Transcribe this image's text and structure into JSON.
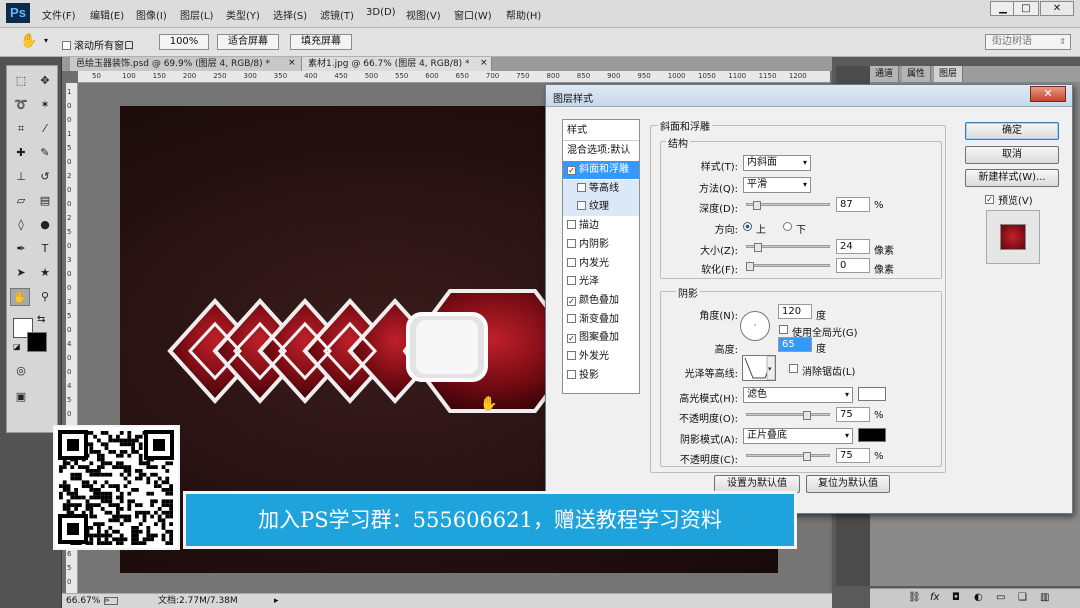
{
  "app": {
    "logo": "Ps"
  },
  "menu": [
    "文件(F)",
    "编辑(E)",
    "图像(I)",
    "图层(L)",
    "类型(Y)",
    "选择(S)",
    "滤镜(T)",
    "3D(D)",
    "视图(V)",
    "窗口(W)",
    "帮助(H)"
  ],
  "window_controls": {
    "minimize": "▁",
    "maximize": "□",
    "close": "✕"
  },
  "options_bar": {
    "hand_icon": "hand-icon",
    "scroll_all_label": "滚动所有窗口",
    "zoom_btn": "100%",
    "fit_btn": "适合屏幕",
    "fill_btn": "填充屏幕",
    "workspace_value": "街边树语"
  },
  "doc_tabs": [
    "邑绘玉器装饰.psd @ 69.9% (图层 4, RGB/8) *",
    "素材1.jpg @ 66.7% (图层 4, RGB/8) *"
  ],
  "ruler_top": [
    "50",
    "100",
    "150",
    "200",
    "250",
    "300",
    "350",
    "400",
    "450",
    "500",
    "550",
    "600",
    "650",
    "700",
    "750",
    "800",
    "850",
    "900",
    "950",
    "1000",
    "1050",
    "1100",
    "1150",
    "1200"
  ],
  "ruler_left": [
    "1",
    "0",
    "0",
    "1",
    "5",
    "0",
    "2",
    "0",
    "0",
    "2",
    "5",
    "0",
    "3",
    "0",
    "0",
    "3",
    "5",
    "0",
    "4",
    "0",
    "0",
    "4",
    "5",
    "0",
    "5",
    "0",
    "0",
    "5",
    "5",
    "0",
    "6",
    "0",
    "0",
    "6",
    "5",
    "0"
  ],
  "status": {
    "zoom": "66.67%",
    "doc": "文档:2.77M/7.38M"
  },
  "panel_tabs": [
    "通道",
    "属性",
    "图层"
  ],
  "dialog": {
    "title": "图层样式",
    "close": "✕",
    "styles_header": "样式",
    "blend_options": "混合选项:默认",
    "style_items": [
      {
        "label": "斜面和浮雕",
        "checked": true,
        "state": "sel"
      },
      {
        "label": "等高线",
        "checked": false,
        "state": "sub"
      },
      {
        "label": "纹理",
        "checked": false,
        "state": "sub"
      },
      {
        "label": "描边",
        "checked": false,
        "state": ""
      },
      {
        "label": "内阴影",
        "checked": false,
        "state": ""
      },
      {
        "label": "内发光",
        "checked": false,
        "state": ""
      },
      {
        "label": "光泽",
        "checked": false,
        "state": ""
      },
      {
        "label": "颜色叠加",
        "checked": true,
        "state": ""
      },
      {
        "label": "渐变叠加",
        "checked": false,
        "state": ""
      },
      {
        "label": "图案叠加",
        "checked": true,
        "state": ""
      },
      {
        "label": "外发光",
        "checked": false,
        "state": ""
      },
      {
        "label": "投影",
        "checked": false,
        "state": ""
      }
    ],
    "bevel_title": "斜面和浮雕",
    "structure": {
      "title": "结构",
      "style_label": "样式(T):",
      "style_value": "内斜面",
      "method_label": "方法(Q):",
      "method_value": "平滑",
      "depth_label": "深度(D):",
      "depth_value": "87",
      "depth_unit": "%",
      "depth_level": 0.09,
      "direction_label": "方向:",
      "dir_up": "上",
      "dir_down": "下",
      "size_label": "大小(Z):",
      "size_value": "24",
      "size_unit": "像素",
      "size_level": 0.1,
      "soften_label": "软化(F):",
      "soften_value": "0",
      "soften_unit": "像素",
      "soften_level": 0
    },
    "shading": {
      "title": "阴影",
      "angle_label": "角度(N):",
      "angle_value": "120",
      "angle_unit": "度",
      "global_light": "使用全局光(G)",
      "altitude_label": "高度:",
      "altitude_value": "65",
      "altitude_unit": "度",
      "gloss_label": "光泽等高线:",
      "antialias": "消除锯齿(L)",
      "highlight_label": "高光模式(H):",
      "highlight_value": "滤色",
      "highlight_color": "#ffffff",
      "hl_opacity_label": "不透明度(O):",
      "hl_opacity_value": "75",
      "hl_opacity_unit": "%",
      "hl_opacity_level": 0.75,
      "shadow_label": "阴影模式(A):",
      "shadow_value": "正片叠底",
      "shadow_color": "#000000",
      "sh_opacity_label": "不透明度(C):",
      "sh_opacity_value": "75",
      "sh_opacity_unit": "%",
      "sh_opacity_level": 0.75
    },
    "make_default": "设置为默认值",
    "reset_default": "复位为默认值",
    "ok": "确定",
    "cancel": "取消",
    "new_style": "新建样式(W)...",
    "preview": "预览(V)"
  },
  "banner": "加入PS学习群：555606621，赠送教程学习资料"
}
